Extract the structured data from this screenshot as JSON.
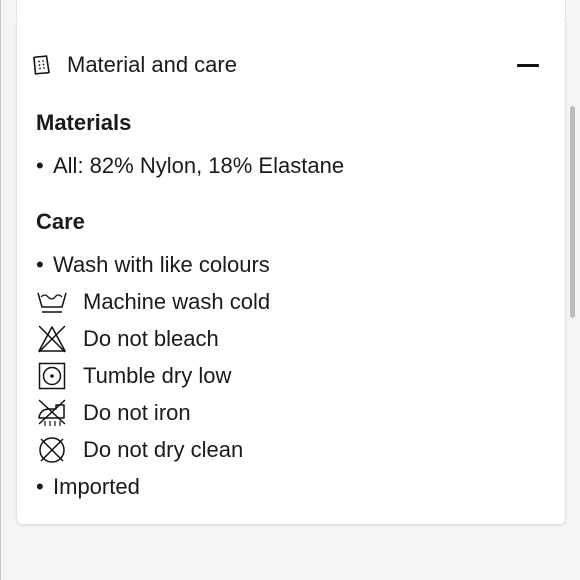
{
  "accordion": {
    "title": "Material and care",
    "icon": "care-label-icon",
    "toggle_icon": "minus-icon"
  },
  "materials": {
    "heading": "Materials",
    "items": [
      "All: 82% Nylon, 18% Elastane"
    ]
  },
  "care": {
    "heading": "Care",
    "bullets": [
      "Wash with like colours",
      "Imported"
    ],
    "instructions": [
      {
        "label": "Machine wash cold",
        "icon": "machine-wash-cold-icon"
      },
      {
        "label": "Do not bleach",
        "icon": "do-not-bleach-icon"
      },
      {
        "label": "Tumble dry low",
        "icon": "tumble-dry-low-icon"
      },
      {
        "label": "Do not iron",
        "icon": "do-not-iron-icon"
      },
      {
        "label": "Do not dry clean",
        "icon": "do-not-dry-clean-icon"
      }
    ]
  },
  "colors": {
    "text": "#1a1a1a",
    "card": "#ffffff",
    "page_background": "#f4f4f5",
    "border": "#e2e2e4"
  }
}
